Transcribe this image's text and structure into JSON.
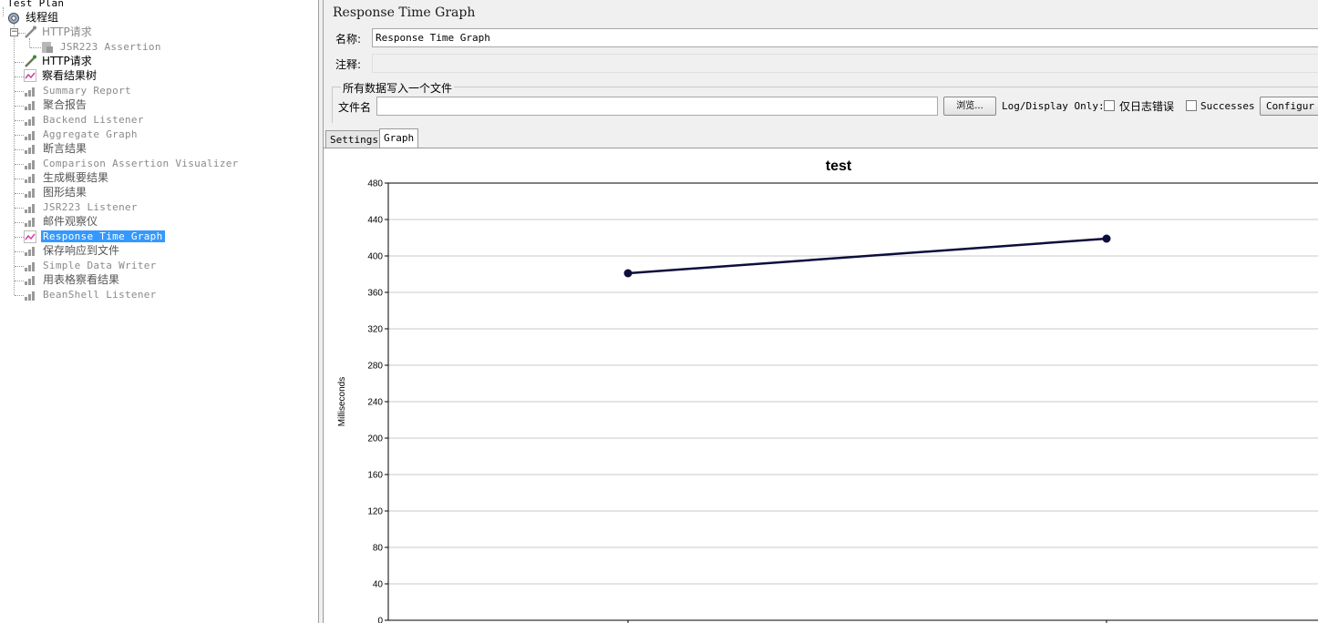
{
  "tree": {
    "items": [
      {
        "label": "Test Plan",
        "icon": "test-plan-icon"
      },
      {
        "label": "线程组",
        "icon": "gear-icon"
      },
      {
        "label": "HTTP请求",
        "icon": "pipette-icon"
      },
      {
        "label": "JSR223 Assertion",
        "icon": "assertion-icon"
      },
      {
        "label": "HTTP请求",
        "icon": "pipette-icon"
      },
      {
        "label": "察看结果树",
        "icon": "graph-icon"
      },
      {
        "label": "Summary Report",
        "icon": "bar-chart-icon"
      },
      {
        "label": "聚合报告",
        "icon": "bar-chart-icon"
      },
      {
        "label": "Backend Listener",
        "icon": "bar-chart-icon"
      },
      {
        "label": "Aggregate Graph",
        "icon": "bar-chart-icon"
      },
      {
        "label": "断言结果",
        "icon": "bar-chart-icon"
      },
      {
        "label": "Comparison Assertion Visualizer",
        "icon": "bar-chart-icon"
      },
      {
        "label": "生成概要结果",
        "icon": "bar-chart-icon"
      },
      {
        "label": "图形结果",
        "icon": "bar-chart-icon"
      },
      {
        "label": "JSR223 Listener",
        "icon": "bar-chart-icon"
      },
      {
        "label": "邮件观察仪",
        "icon": "bar-chart-icon"
      },
      {
        "label": "Response Time Graph",
        "icon": "graph-icon"
      },
      {
        "label": "保存响应到文件",
        "icon": "bar-chart-icon"
      },
      {
        "label": "Simple Data Writer",
        "icon": "bar-chart-icon"
      },
      {
        "label": "用表格察看结果",
        "icon": "bar-chart-icon"
      },
      {
        "label": "BeanShell Listener",
        "icon": "bar-chart-icon"
      }
    ]
  },
  "panel": {
    "title": "Response Time Graph",
    "name_label": "名称:",
    "name_value": "Response Time Graph",
    "comment_label": "注释:",
    "comment_value": "",
    "file_group_title": "所有数据写入一个文件",
    "filename_label": "文件名",
    "filename_value": "",
    "browse_label": "浏览...",
    "log_display_label": "Log/Display Only:",
    "errors_only_label": "仅日志错误",
    "successes_label": "Successes",
    "configure_label": "Configur"
  },
  "tabs": [
    {
      "label": "Settings"
    },
    {
      "label": "Graph"
    }
  ],
  "chart_data": {
    "type": "line",
    "title": "test",
    "xlabel": "",
    "ylabel": "Milliseconds",
    "ylim": [
      0,
      480
    ],
    "yticks": [
      0,
      40,
      80,
      120,
      160,
      200,
      240,
      280,
      320,
      360,
      400,
      440,
      480
    ],
    "grid": true,
    "series": [
      {
        "values": [
          381,
          419
        ]
      }
    ],
    "color": "#0d0d3d"
  }
}
